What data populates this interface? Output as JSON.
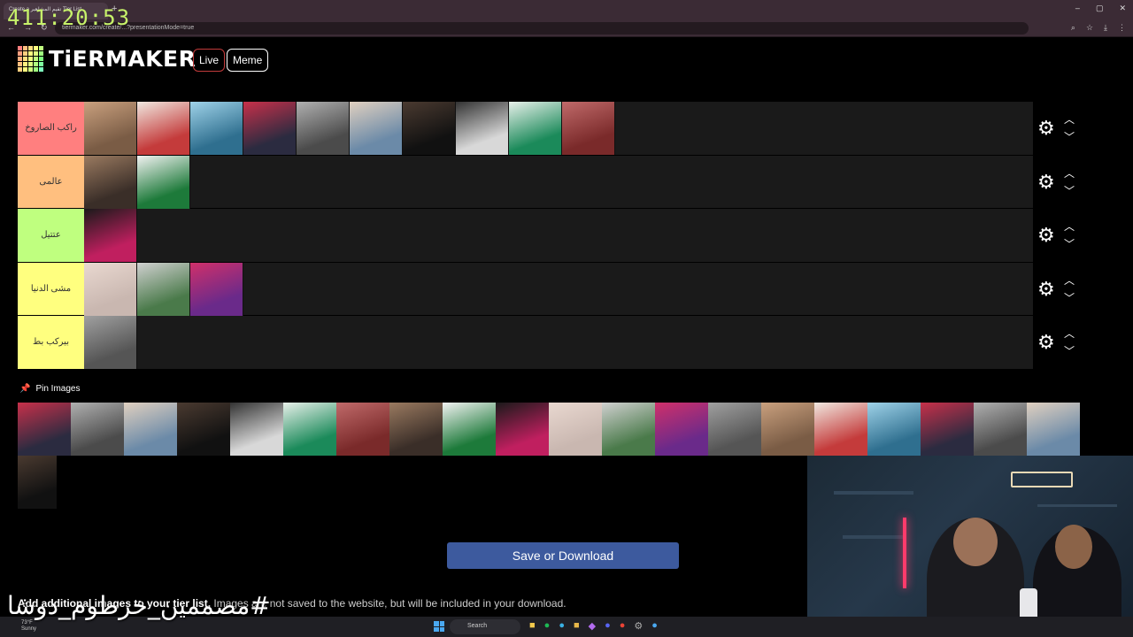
{
  "browser": {
    "tab_title": "Create a تقيم المشاهير Tier List",
    "url": "tiermaker.com/create/...?presentationMode=true",
    "new_tab": "+",
    "window_controls": [
      "–",
      "▢",
      "✕"
    ]
  },
  "stream_timer": "411:20:53",
  "header": {
    "logo_text": "TiERMAKER",
    "live_label": "Live",
    "meme_label": "Meme"
  },
  "tiers": [
    {
      "label": "راكب الصاروخ",
      "color": "#ff7f7f",
      "count": 10
    },
    {
      "label": "عالمى",
      "color": "#ffbf7f",
      "count": 2
    },
    {
      "label": "عتتيل",
      "color": "#bfff7f",
      "count": 1
    },
    {
      "label": "مشى الدنيا",
      "color": "#ffff7f",
      "count": 3
    },
    {
      "label": "بيركب بط",
      "color": "#ffff7f",
      "count": 1
    }
  ],
  "tier_controls": {
    "gear_icon": "gear-icon",
    "up_icon": "chevron-up-icon",
    "down_icon": "chevron-down-icon"
  },
  "pin_label": "Pin Images",
  "pool_count": 21,
  "save_label": "Save or Download",
  "add_text_bold": "Add additional images to your tier list.",
  "add_text_rest": " Images are not saved to the website, but will be included in your download.",
  "hashtag": "#مصممين_خرطوم_دوشا",
  "taskbar": {
    "weather_temp": "73°F",
    "weather_desc": "Sunny",
    "search_placeholder": "Search"
  },
  "colors": {
    "accent_button": "#3d5a9e",
    "tier_bg": "#1a1a1a",
    "timer": "#c7f26a"
  }
}
